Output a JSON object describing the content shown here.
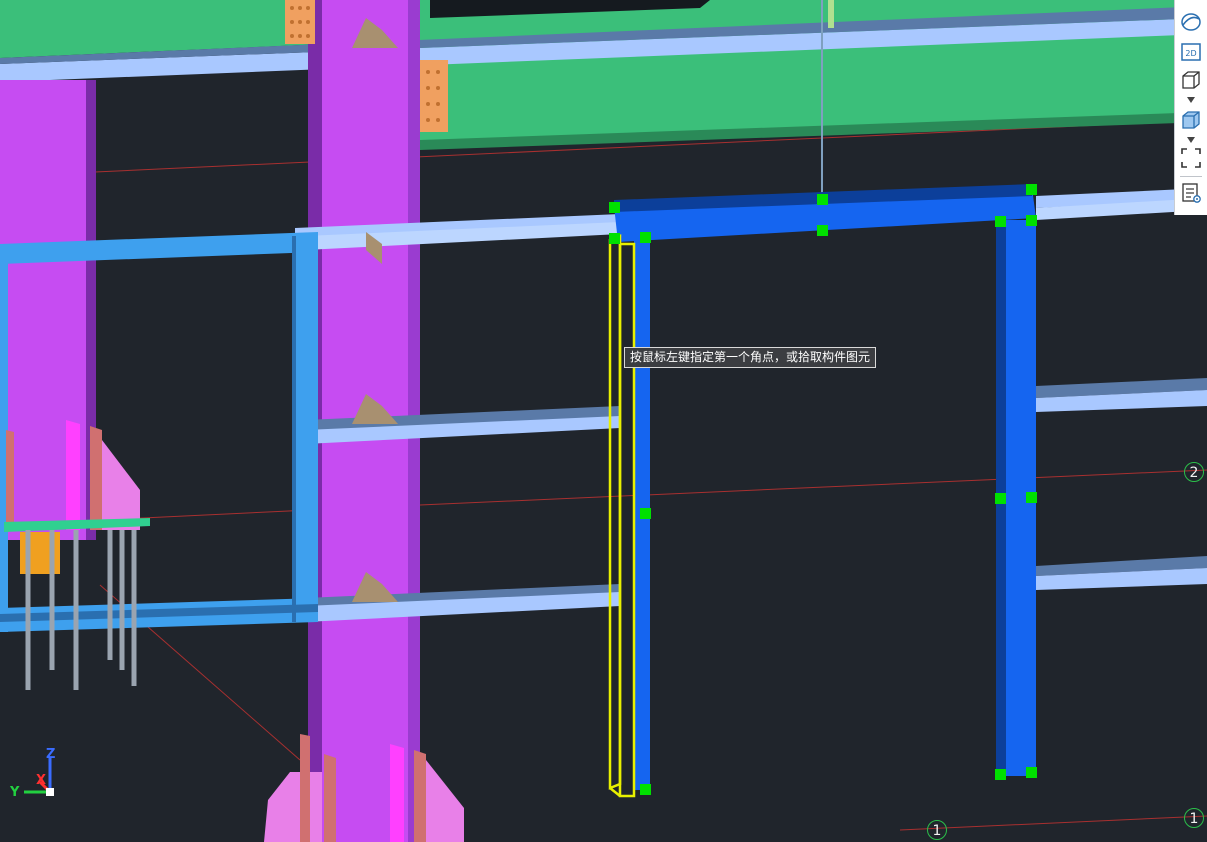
{
  "tooltip": {
    "text": "按鼠标左键指定第一个角点，或拾取构件图元"
  },
  "grid_axes": [
    {
      "id": "axis-2-right",
      "label": "2"
    },
    {
      "id": "axis-1-bottom",
      "label": "1"
    },
    {
      "id": "axis-1-right",
      "label": "1"
    }
  ],
  "toolbar": {
    "items": [
      {
        "icon": "orbit-icon"
      },
      {
        "icon": "view-2d-icon",
        "label": "2D"
      },
      {
        "icon": "wireframe-box-icon",
        "has_dropdown": true
      },
      {
        "icon": "shaded-box-icon",
        "has_dropdown": true
      },
      {
        "icon": "zoom-extents-icon"
      },
      {
        "icon": "properties-view-icon"
      }
    ]
  },
  "view_axes": {
    "y": "Y",
    "z": "Z",
    "x": "X"
  },
  "colors": {
    "background": "#20252c",
    "column_magenta": "#c64cf2",
    "beam_green": "#3bbf7a",
    "purlin_light_blue": "#a9c8ff",
    "beam_blue": "#3ea0ee",
    "selected_frame_blue": "#1565f0",
    "grip_green": "#00e000",
    "highlight_yellow": "#e8f000",
    "grid_line_red": "#a83030"
  }
}
